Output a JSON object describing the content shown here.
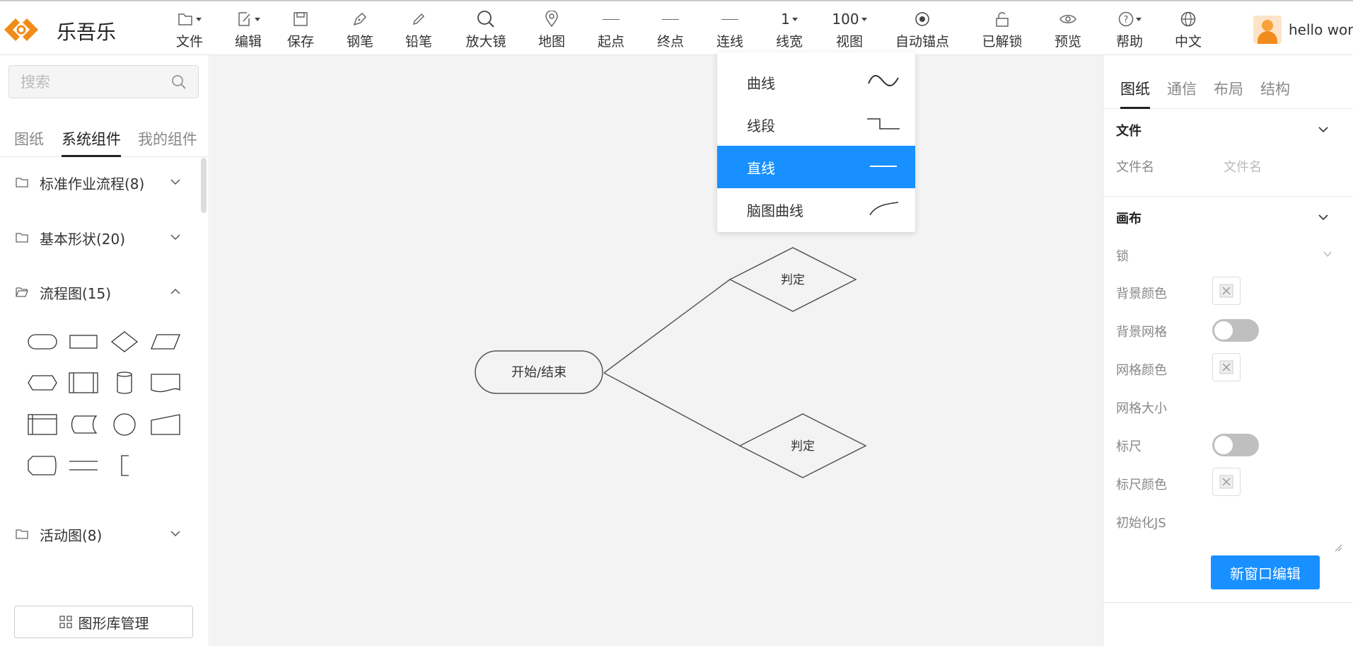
{
  "app": {
    "brand": "乐吾乐",
    "username": "hello worl"
  },
  "toolbar": [
    {
      "key": "file",
      "label": "文件",
      "icon": "file-icon",
      "caret": true
    },
    {
      "key": "edit",
      "label": "编辑",
      "icon": "edit-icon",
      "caret": true
    },
    {
      "key": "save",
      "label": "保存",
      "icon": "save-icon",
      "caret": false
    },
    {
      "key": "pen",
      "label": "钢笔",
      "icon": "pen-icon",
      "caret": false
    },
    {
      "key": "pencil",
      "label": "铅笔",
      "icon": "pencil-icon",
      "caret": false
    },
    {
      "key": "magnifier",
      "label": "放大镜",
      "icon": "magnifier-icon",
      "caret": false
    },
    {
      "key": "map",
      "label": "地图",
      "icon": "map-pin-icon",
      "caret": false
    },
    {
      "key": "start",
      "label": "起点",
      "icon": "line-start-icon",
      "caret": false
    },
    {
      "key": "end",
      "label": "终点",
      "icon": "line-end-icon",
      "caret": false
    },
    {
      "key": "connect",
      "label": "连线",
      "icon": "line-icon",
      "caret": false
    },
    {
      "key": "linewidth",
      "label": "线宽",
      "value": "1",
      "caret": true
    },
    {
      "key": "view",
      "label": "视图",
      "value": "100",
      "caret": true
    },
    {
      "key": "autoanchor",
      "label": "自动锚点",
      "icon": "anchor-icon",
      "caret": false
    },
    {
      "key": "unlocked",
      "label": "已解锁",
      "icon": "unlock-icon",
      "caret": false
    },
    {
      "key": "preview",
      "label": "预览",
      "icon": "eye-icon",
      "caret": false
    },
    {
      "key": "help",
      "label": "帮助",
      "icon": "help-icon",
      "caret": true
    },
    {
      "key": "language",
      "label": "中文",
      "icon": "globe-icon",
      "caret": false
    }
  ],
  "search": {
    "placeholder": "搜索"
  },
  "left_tabs": [
    {
      "label": "图纸",
      "active": false
    },
    {
      "label": "系统组件",
      "active": true
    },
    {
      "label": "我的组件",
      "active": false
    }
  ],
  "categories": [
    {
      "label": "标准作业流程(8)",
      "expanded": false
    },
    {
      "label": "基本形状(20)",
      "expanded": false
    },
    {
      "label": "流程图(15)",
      "expanded": true
    },
    {
      "label": "活动图(8)",
      "expanded": false
    }
  ],
  "library_button": "图形库管理",
  "line_menu": [
    {
      "label": "曲线",
      "icon": "curve-icon",
      "selected": false
    },
    {
      "label": "线段",
      "icon": "polyline-icon",
      "selected": false
    },
    {
      "label": "直线",
      "icon": "straight-line-icon",
      "selected": true
    },
    {
      "label": "脑图曲线",
      "icon": "mindmap-curve-icon",
      "selected": false
    }
  ],
  "diagram": {
    "start_node": "开始/结束",
    "decision_top": "判定",
    "decision_bottom": "判定"
  },
  "right_tabs": [
    {
      "label": "图纸",
      "active": true
    },
    {
      "label": "通信",
      "active": false
    },
    {
      "label": "布局",
      "active": false
    },
    {
      "label": "结构",
      "active": false
    }
  ],
  "file_section": {
    "title": "文件",
    "filename_label": "文件名",
    "filename_placeholder": "文件名"
  },
  "canvas_section": {
    "title": "画布",
    "lock": "锁",
    "bg_color": "背景颜色",
    "bg_grid": "背景网格",
    "grid_color": "网格颜色",
    "grid_size": "网格大小",
    "ruler": "标尺",
    "ruler_color": "标尺颜色",
    "init_js": "初始化JS",
    "new_window_button": "新窗口编辑"
  },
  "colors": {
    "accent": "#1890ff",
    "logo": "#f08c1a"
  }
}
